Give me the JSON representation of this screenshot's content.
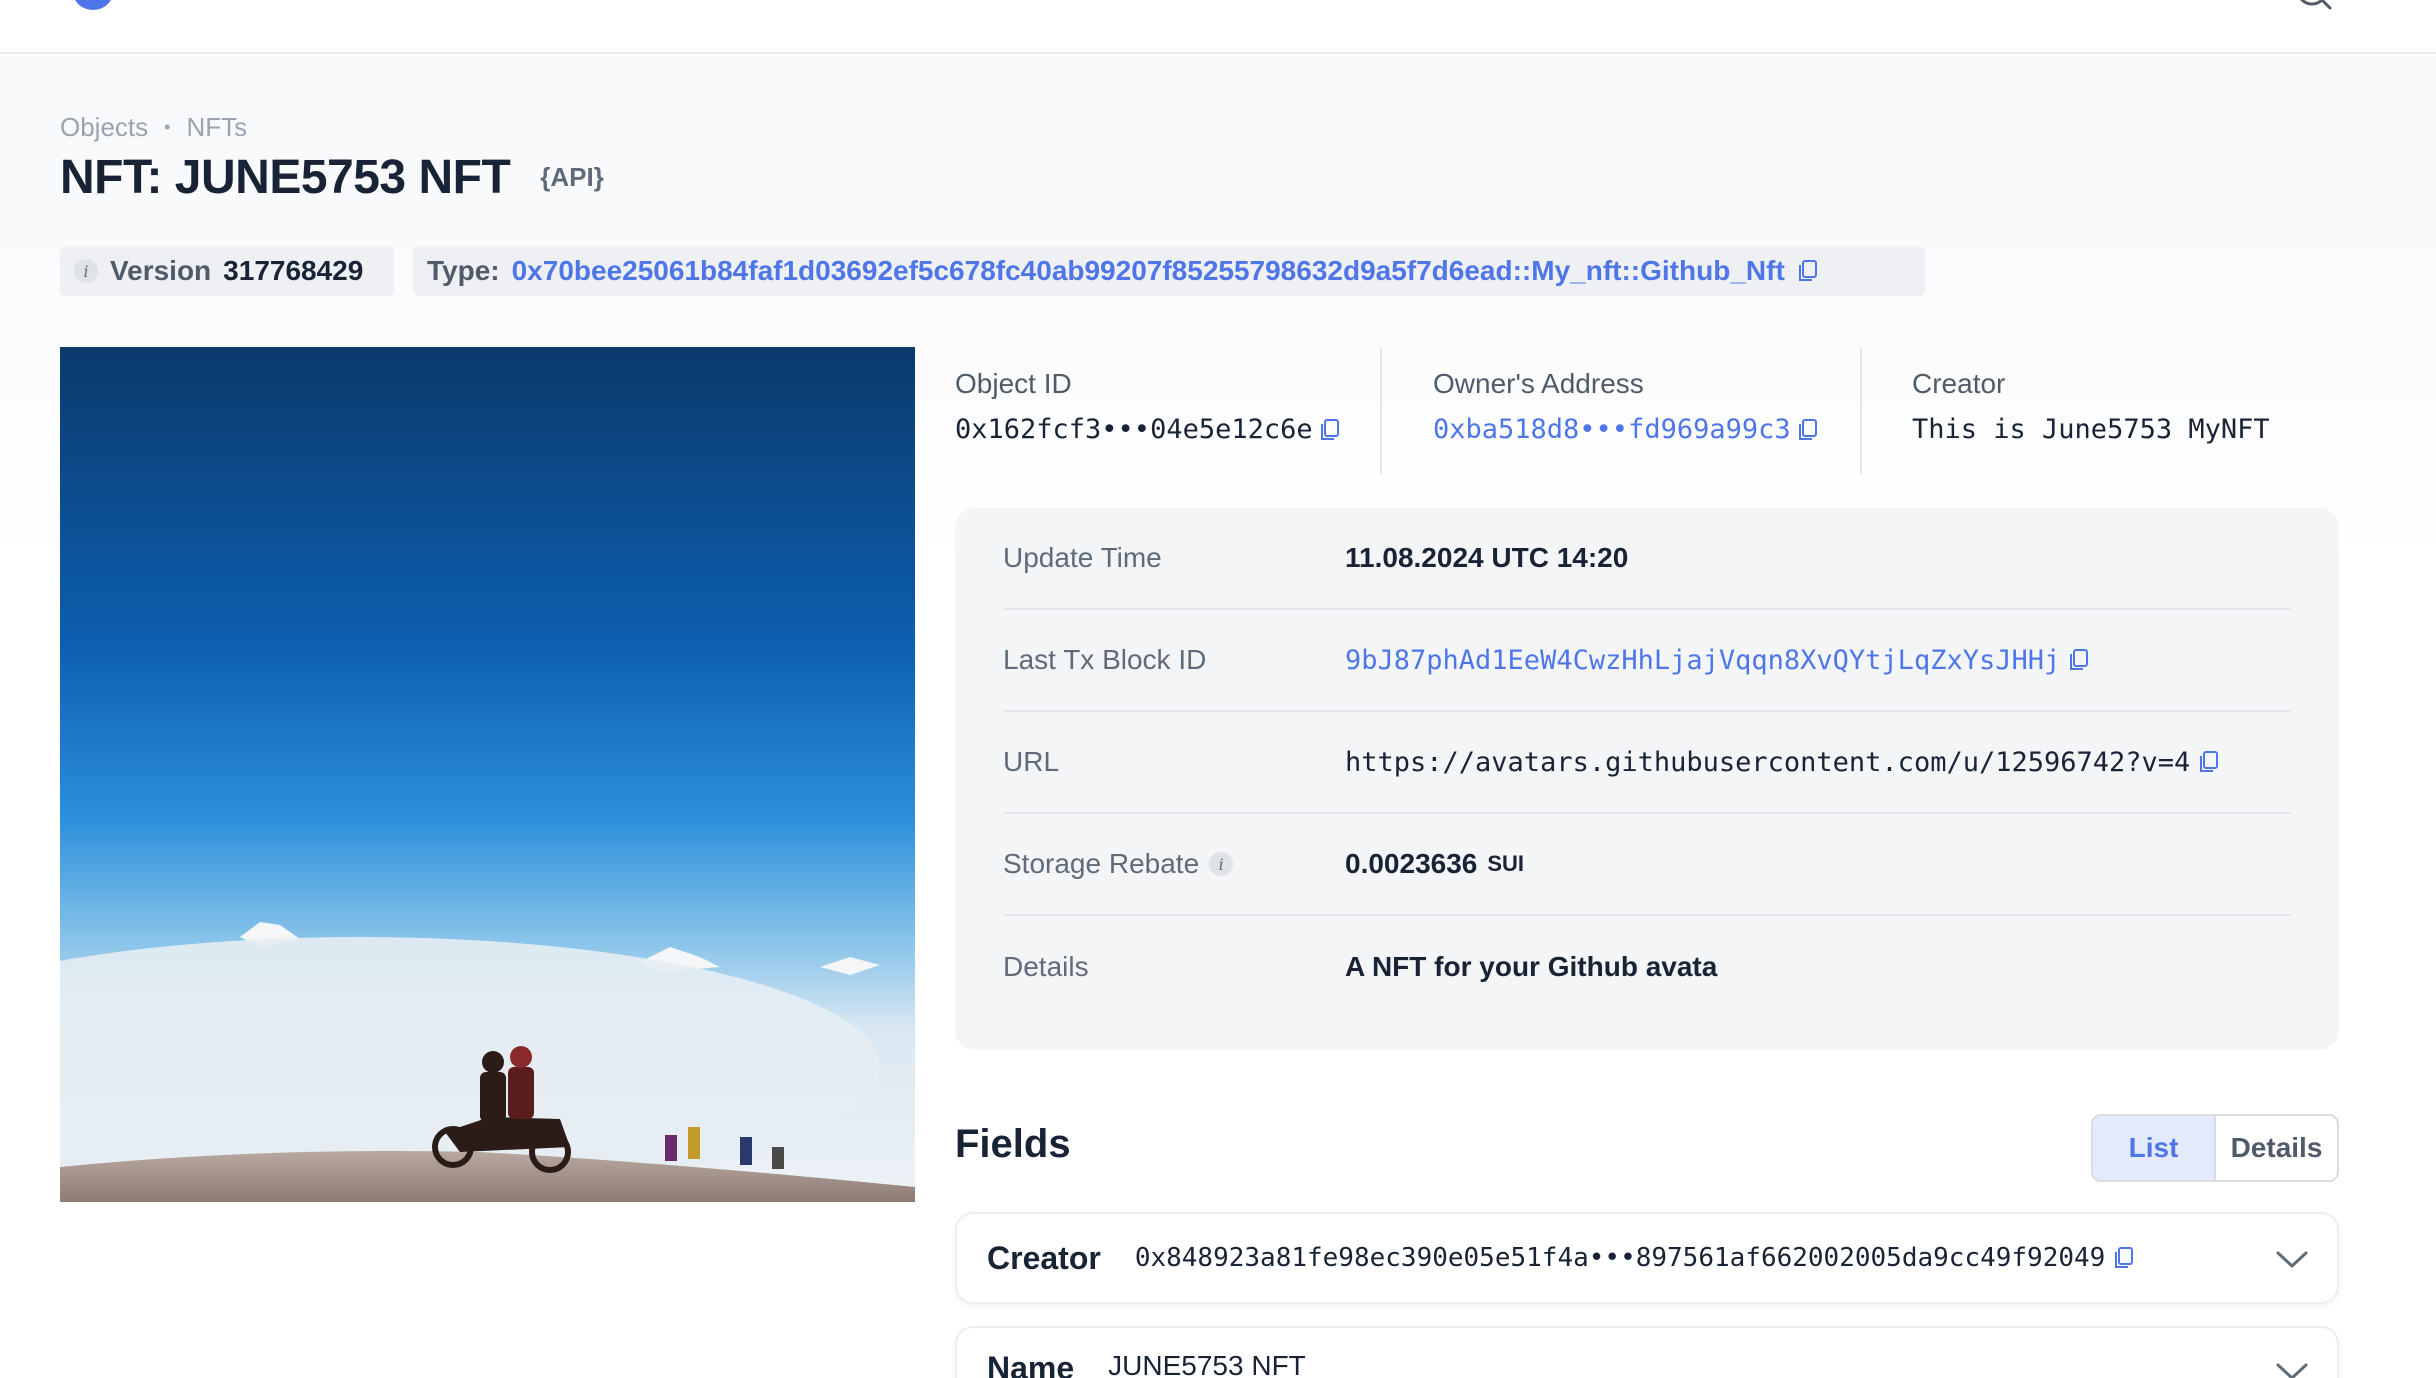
{
  "breadcrumb": {
    "objects": "Objects",
    "nfts": "NFTs"
  },
  "page": {
    "title": "NFT: JUNE5753 NFT",
    "api_tag": "{API}"
  },
  "version": {
    "label": "Version",
    "value": "317768429"
  },
  "type": {
    "label": "Type:",
    "value": "0x70bee25061b84faf1d03692ef5c678fc40ab99207f85255798632d9a5f7d6ead::My_nft::Github_Nft"
  },
  "meta": {
    "object_id_label": "Object ID",
    "object_id": "0x162fcf3•••04e5e12c6e",
    "owner_label": "Owner's Address",
    "owner": "0xba518d8•••fd969a99c3",
    "creator_label": "Creator",
    "creator": "This is June5753 MyNFT"
  },
  "details": {
    "update_time_label": "Update Time",
    "update_time": "11.08.2024 UTC 14:20",
    "last_tx_label": "Last Tx Block ID",
    "last_tx": "9bJ87phAd1EeW4CwzHhLjajVqqn8XvQYtjLqZxYsJHHj",
    "url_label": "URL",
    "url": "https://avatars.githubusercontent.com/u/12596742?v=4",
    "rebate_label": "Storage Rebate",
    "rebate": "0.0023636",
    "rebate_unit": "SUI",
    "details_label": "Details",
    "details_value": "A NFT for your Github avata"
  },
  "fields": {
    "title": "Fields",
    "list_label": "List",
    "details_label": "Details",
    "items": [
      {
        "name": "Creator",
        "value": "0x848923a81fe98ec390e05e51f4a•••897561af662002005da9cc49f92049"
      },
      {
        "name": "Name",
        "value": "JUNE5753 NFT"
      }
    ]
  },
  "colors": {
    "link": "#4f76e8",
    "accent_bg": "#e3eafc",
    "card_bg": "#f4f5f7"
  },
  "icons": [
    "logo-icon",
    "search-icon",
    "info-icon",
    "copy-icon",
    "chevron-down-icon"
  ]
}
